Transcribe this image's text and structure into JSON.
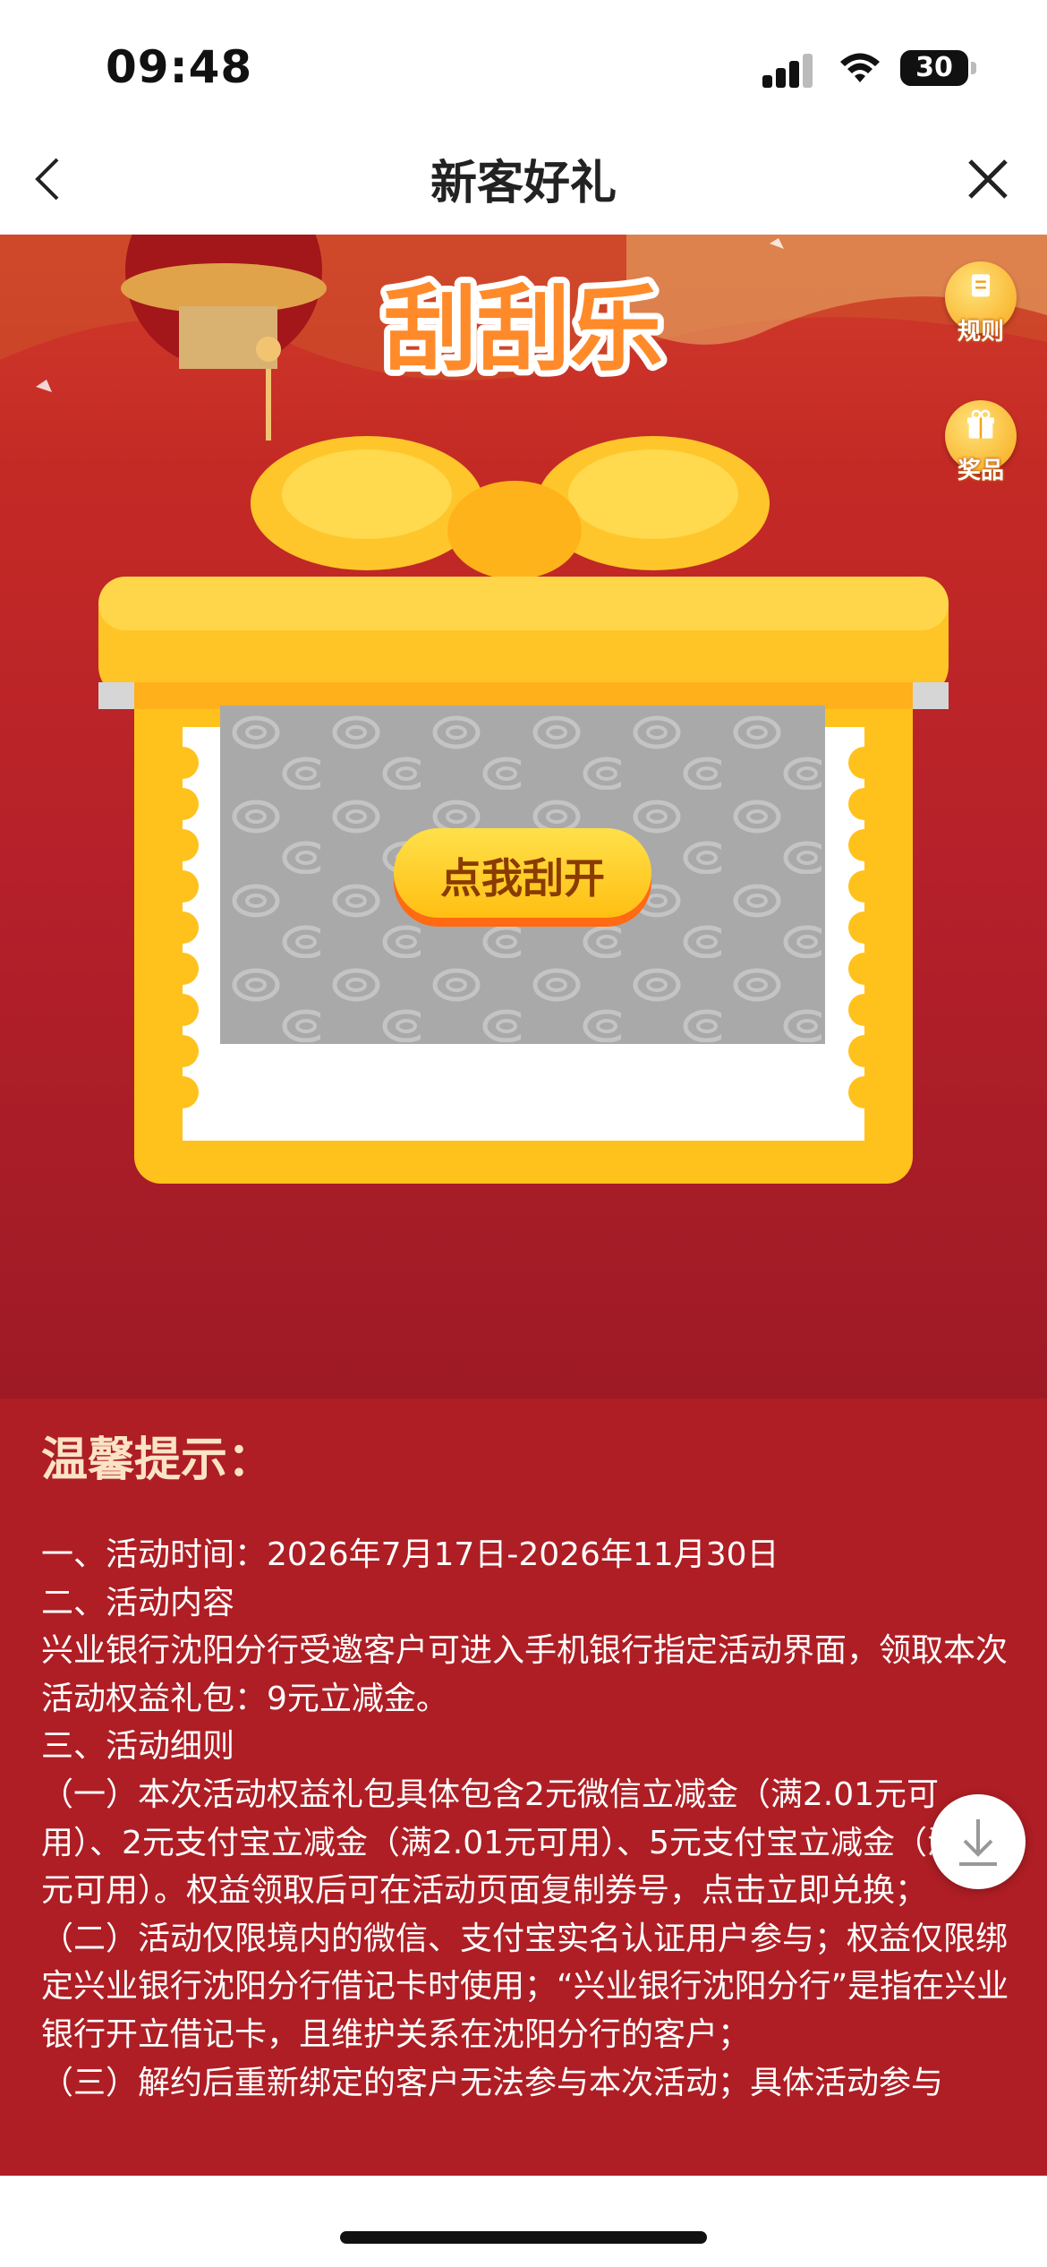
{
  "status_bar": {
    "time": "09:48",
    "battery": "30"
  },
  "nav": {
    "title": "新客好礼"
  },
  "hero": {
    "title_art": "刮刮乐",
    "rules_label": "规则",
    "prize_label": "奖品",
    "scratch_button": "点我刮开"
  },
  "tips": {
    "title": "温馨提示：",
    "lines": [
      "一、活动时间：2026年7月17日-2026年11月30日",
      "二、活动内容",
      "兴业银行沈阳分行受邀客户可进入手机银行指定活动界面，领取本次活动权益礼包：9元立减金。",
      "三、活动细则",
      "（一）本次活动权益礼包具体包含2元微信立减金（满2.01元可用）、2元支付宝立减金（满2.01元可用）、5元支付宝立减金（满60元可用）。权益领取后可在活动页面复制券号，点击立即兑换；",
      "（二）活动仅限境内的微信、支付宝实名认证用户参与；权益仅限绑定兴业银行沈阳分行借记卡时使用；“兴业银行沈阳分行”是指在兴业银行开立借记卡，且维护关系在沈阳分行的客户；",
      "（三）解约后重新绑定的客户无法参与本次活动；具体活动参与"
    ]
  },
  "colors": {
    "primary_red": "#b71d26",
    "gold": "#ffc21c",
    "button_orange": "#ff6a12"
  }
}
